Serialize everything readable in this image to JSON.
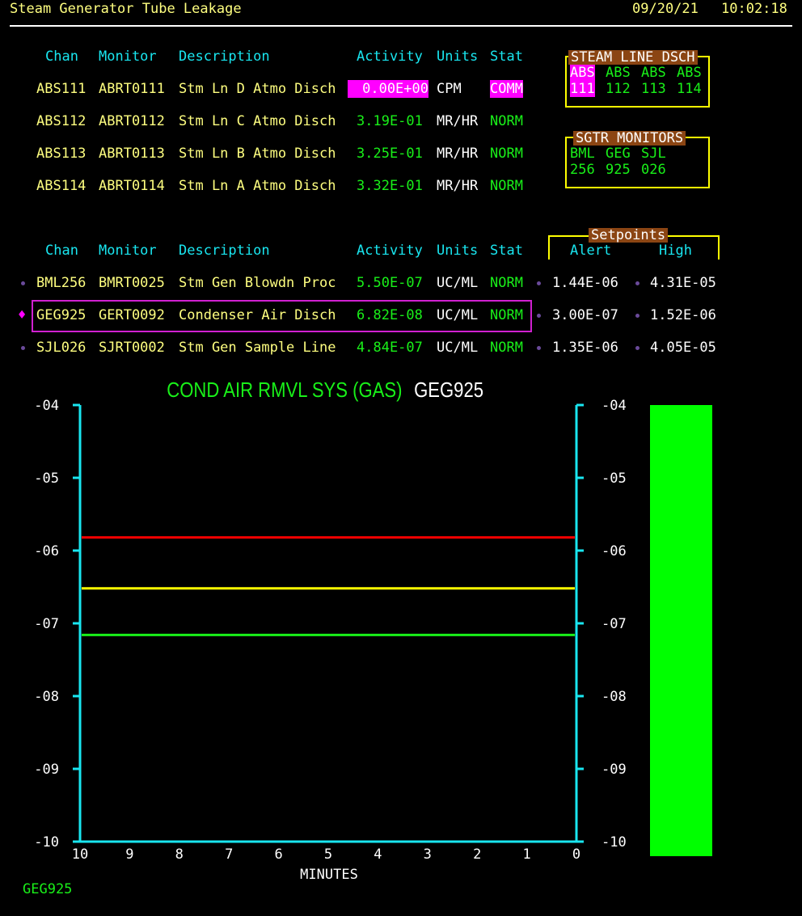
{
  "header": {
    "title": "Steam Generator Tube Leakage",
    "date": "09/20/21",
    "time": "10:02:18"
  },
  "table1": {
    "columns": [
      "Chan",
      "Monitor",
      "Description",
      "Activity",
      "Units",
      "Stat"
    ],
    "rows": [
      {
        "chan": "ABS111",
        "monitor": "ABRT0111",
        "desc": "Stm Ln D Atmo Disch",
        "activity": "0.00E+00",
        "units": "CPM",
        "stat": "COMM"
      },
      {
        "chan": "ABS112",
        "monitor": "ABRT0112",
        "desc": "Stm Ln C Atmo Disch",
        "activity": "3.19E-01",
        "units": "MR/HR",
        "stat": "NORM"
      },
      {
        "chan": "ABS113",
        "monitor": "ABRT0113",
        "desc": "Stm Ln B Atmo Disch",
        "activity": "3.25E-01",
        "units": "MR/HR",
        "stat": "NORM"
      },
      {
        "chan": "ABS114",
        "monitor": "ABRT0114",
        "desc": "Stm Ln A Atmo Disch",
        "activity": "3.32E-01",
        "units": "MR/HR",
        "stat": "NORM"
      }
    ]
  },
  "steam_line_box": {
    "title": "STEAM LINE DSCH",
    "top": [
      "ABS",
      "ABS",
      "ABS",
      "ABS"
    ],
    "bottom": [
      "111",
      "112",
      "113",
      "114"
    ]
  },
  "sgtr_box": {
    "title": "SGTR MONITORS",
    "top": [
      "BML",
      "GEG",
      "SJL"
    ],
    "bottom": [
      "256",
      "925",
      "026"
    ]
  },
  "table2": {
    "columns": [
      "Chan",
      "Monitor",
      "Description",
      "Activity",
      "Units",
      "Stat"
    ],
    "setpoints_title": "Setpoints",
    "setpoints_cols": [
      "Alert",
      "High"
    ],
    "rows": [
      {
        "chan": "BML256",
        "monitor": "BMRT0025",
        "desc": "Stm Gen Blowdn Proc",
        "activity": "5.50E-07",
        "units": "UC/ML",
        "stat": "NORM",
        "alert": "1.44E-06",
        "high": "4.31E-05"
      },
      {
        "chan": "GEG925",
        "monitor": "GERT0092",
        "desc": "Condenser Air Disch",
        "activity": "6.82E-08",
        "units": "UC/ML",
        "stat": "NORM",
        "alert": "3.00E-07",
        "high": "1.52E-06"
      },
      {
        "chan": "SJL026",
        "monitor": "SJRT0002",
        "desc": "Stm Gen Sample Line",
        "activity": "4.84E-07",
        "units": "UC/ML",
        "stat": "NORM",
        "alert": "1.35E-06",
        "high": "4.05E-05"
      }
    ],
    "selected_marker": "♦"
  },
  "chart_data": {
    "type": "line",
    "title": "COND AIR RMVL SYS (GAS)",
    "channel_label": "GEG925",
    "xlabel": "MINUTES",
    "x_ticks": [
      "10",
      "9",
      "8",
      "7",
      "6",
      "5",
      "4",
      "3",
      "2",
      "1",
      "0"
    ],
    "y_ticks": [
      "-04",
      "-05",
      "-06",
      "-07",
      "-08",
      "-09",
      "-10"
    ],
    "ylim": [
      -10,
      -4
    ],
    "log_scale": true,
    "grid": false,
    "series": [],
    "reference_lines": [
      {
        "value": -5.82,
        "color": "#ff0000"
      },
      {
        "value": -6.52,
        "color": "#ffff00"
      },
      {
        "value": -7.16,
        "color": "#19f019"
      }
    ],
    "bar": {
      "min": -10,
      "max": -4,
      "color": "#00ff00"
    }
  },
  "footer": {
    "label": "GEG925"
  },
  "colors": {
    "background": "#000000",
    "axis": "#19e6f0",
    "accent": "#ff00ff",
    "norm": "#19f019"
  }
}
